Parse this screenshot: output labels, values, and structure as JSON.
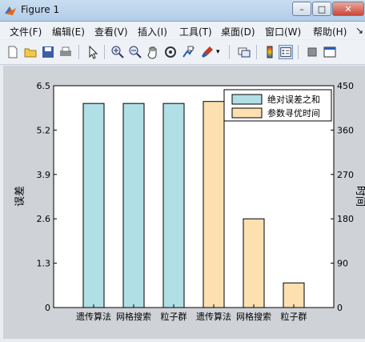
{
  "window": {
    "title": "Figure 1"
  },
  "menu": [
    "文件(F)",
    "编辑(E)",
    "查看(V)",
    "插入(I)",
    "工具(T)",
    "桌面(D)",
    "窗口(W)",
    "帮助(H)"
  ],
  "toolbar_icons": [
    "new-file-icon",
    "open-folder-icon",
    "save-icon",
    "print-icon",
    "pointer-icon",
    "zoom-in-icon",
    "zoom-out-icon",
    "pan-icon",
    "rotate-icon",
    "data-cursor-icon",
    "brush-icon",
    "link-icon",
    "colorbar-icon",
    "legend-icon",
    "hide-plot-tools-icon",
    "show-plot-tools-icon"
  ],
  "colors": {
    "blue": "#b0dfe6",
    "orange": "#fde0b0",
    "edge": "#000000"
  },
  "chart_data": {
    "type": "bar",
    "categories": [
      "遗传算法",
      "网格搜索",
      "粒子群",
      "遗传算法",
      "网格搜索",
      "粒子群"
    ],
    "series": [
      {
        "name": "绝对误差之和",
        "axis": "left",
        "color": "#b0dfe6",
        "values": [
          5.98,
          5.98,
          5.98,
          null,
          null,
          null
        ]
      },
      {
        "name": "参数寻优时间",
        "axis": "right",
        "color": "#fde0b0",
        "values": [
          null,
          null,
          null,
          418,
          180,
          50
        ]
      }
    ],
    "ylabel_left": "误差",
    "ylabel_right": "时间",
    "yticks_left": [
      "0",
      "1.3",
      "2.6",
      "3.9",
      "5.2",
      "6.5"
    ],
    "yticks_right": [
      "0",
      "90",
      "180",
      "270",
      "360",
      "450"
    ],
    "ylim_left": [
      0,
      6.5
    ],
    "ylim_right": [
      0,
      450
    ],
    "legend": "top-right",
    "grid": false
  }
}
